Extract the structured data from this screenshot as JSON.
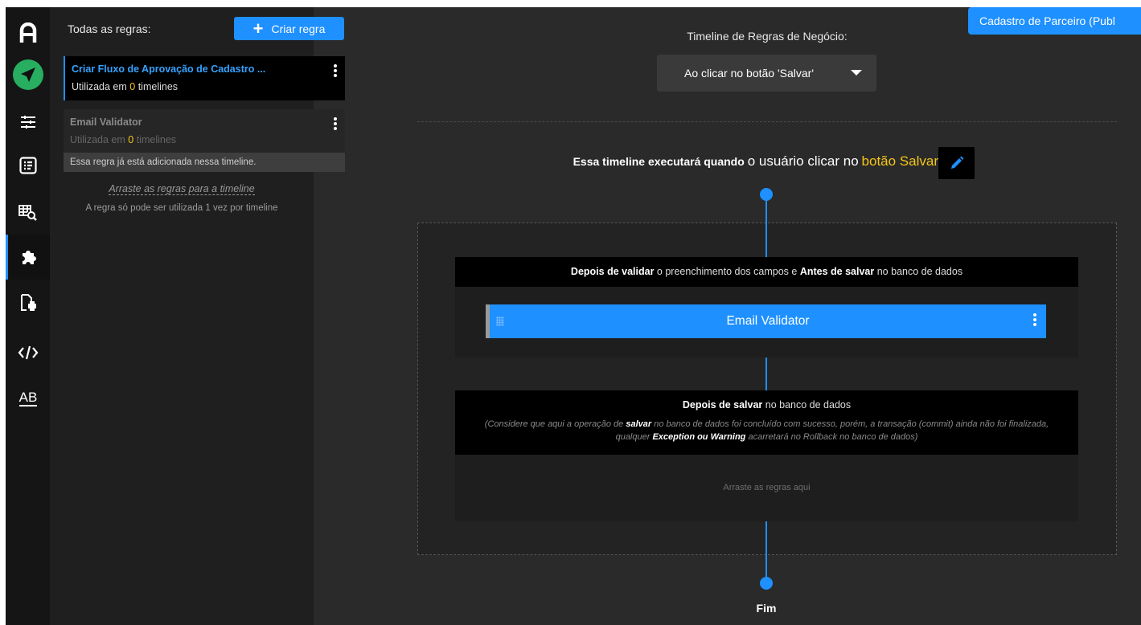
{
  "sidebar": {
    "items": [
      {
        "name": "logo-icon",
        "glyph": "A"
      },
      {
        "name": "send-icon"
      },
      {
        "name": "sliders-icon"
      },
      {
        "name": "list-panel-icon"
      },
      {
        "name": "table-search-icon"
      },
      {
        "name": "puzzle-icon",
        "active": true
      },
      {
        "name": "file-print-icon"
      },
      {
        "name": "code-icon",
        "glyph": "</>"
      },
      {
        "name": "ab-icon",
        "glyph": "AB"
      }
    ]
  },
  "rules_panel": {
    "heading": "Todas as regras:",
    "new_rule_plus": "+",
    "new_rule_label": "Criar regra",
    "rules": [
      {
        "title": "Criar Fluxo de Aprovação de Cadastro ...",
        "used_prefix": "Utilizada em",
        "used_count": "0",
        "used_suffix": "timelines",
        "selected": true
      },
      {
        "title": "Email Validator",
        "used_prefix": "Utilizada em",
        "used_count": "0",
        "used_suffix": "timelines",
        "note": "Essa regra já está adicionada nessa timeline."
      }
    ],
    "drag_hint": "Arraste as regras para a timeline",
    "limit_hint": "A regra só pode ser utilizada 1 vez por timeline"
  },
  "main": {
    "top_tab": "Cadastro de Parceiro (Publ",
    "timeline_title": "Timeline de Regras de Negócio:",
    "timeline_select": "Ao clicar no botão 'Salvar'",
    "execute": {
      "prefix": "Essa timeline executará quando",
      "user_action": "o usuário clicar no",
      "target": "botão Salvar"
    },
    "block1": {
      "head_bold1": "Depois de validar",
      "head_mid": "o preenchimento dos campos e",
      "head_bold2": "Antes de salvar",
      "head_end": "no banco de dados",
      "rule": "Email Validator"
    },
    "block2": {
      "head_bold": "Depois de salvar",
      "head_end": "no banco de dados",
      "note_1": "(Considere que aqui a operação de",
      "note_bold1": "salvar",
      "note_2": "no banco de dados foi concluído com sucesso, porém, a transação (commit) ainda não foi finalizada, qualquer",
      "note_bold2": "Exception ou Warning",
      "note_3": "acarretará no Rollback no banco de dados)",
      "drop_hint": "Arraste as regras aqui"
    },
    "end_label": "Fim"
  },
  "colors": {
    "accent": "#1e90ff",
    "highlight": "#f5c518",
    "background": "#2a2a2a"
  }
}
